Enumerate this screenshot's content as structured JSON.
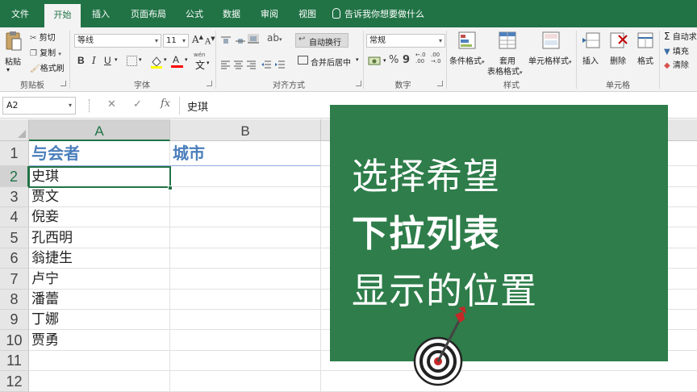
{
  "ribbon_tabs": [
    {
      "label": "文件",
      "active": false
    },
    {
      "label": "开始",
      "active": true
    },
    {
      "label": "插入",
      "active": false
    },
    {
      "label": "页面布局",
      "active": false
    },
    {
      "label": "公式",
      "active": false
    },
    {
      "label": "数据",
      "active": false
    },
    {
      "label": "审阅",
      "active": false
    },
    {
      "label": "视图",
      "active": false
    }
  ],
  "tell_me": "告诉我你想要做什么",
  "clipboard": {
    "paste": "粘贴",
    "cut": "剪切",
    "copy": "复制",
    "format_painter": "格式刷",
    "group_label": "剪贴板"
  },
  "font": {
    "name": "等线",
    "size": "11",
    "bold": "B",
    "italic": "I",
    "underline": "U",
    "grow": "A",
    "shrink": "A",
    "wen": "wén",
    "font_color_letter": "A",
    "group_label": "字体"
  },
  "alignment": {
    "wrap_text": "自动换行",
    "merge_center": "合并后居中",
    "group_label": "对齐方式"
  },
  "number": {
    "format": "常规",
    "percent": "%",
    "comma": "9",
    "group_label": "数字"
  },
  "styles": {
    "conditional": "条件格式",
    "table_format_1": "套用",
    "table_format_2": "表格格式",
    "cell_styles": "单元格样式",
    "group_label": "样式"
  },
  "cells": {
    "insert": "插入",
    "delete": "删除",
    "format": "格式",
    "group_label": "单元格"
  },
  "editing": {
    "autosum": "自动求",
    "fill": "填充",
    "clear": "清除"
  },
  "formula_bar": {
    "name_box": "A2",
    "cancel": "✕",
    "enter": "✓",
    "fx": "fx",
    "value": "史琪"
  },
  "sheet": {
    "columns": [
      "A",
      "B"
    ],
    "rows": [
      "1",
      "2",
      "3",
      "4",
      "5",
      "6",
      "7",
      "8",
      "9",
      "10",
      "11",
      "12"
    ],
    "header_row": [
      "与会者",
      "城市"
    ],
    "col_a": [
      "史琪",
      "贾文",
      "倪妾",
      "孔西明",
      "翁捷生",
      "卢宁",
      "潘蕾",
      "丁娜",
      "贾勇"
    ]
  },
  "overlay": {
    "line1": "选择希望",
    "line2": "下拉列表",
    "line3": "显示的位置"
  },
  "colors": {
    "excel_green": "#217346",
    "card_green": "#2e7d4a",
    "header_blue": "#4a7ebb"
  }
}
